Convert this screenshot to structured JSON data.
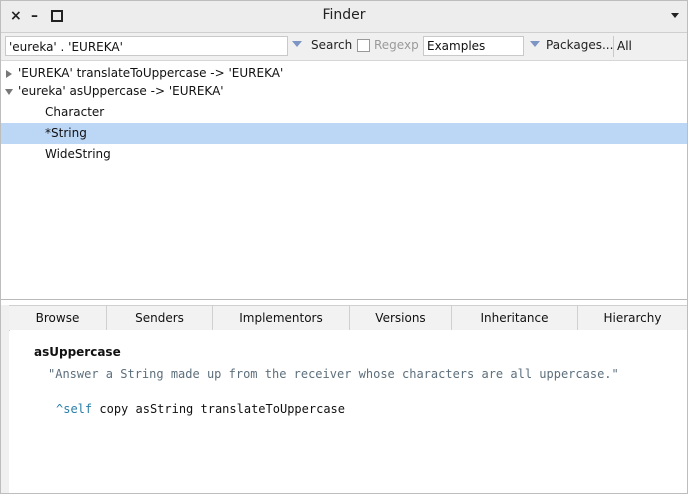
{
  "window": {
    "title": "Finder",
    "close_glyph": "×",
    "minimize_glyph": "–"
  },
  "toolbar": {
    "search_value": "'eureka' . 'EUREKA'",
    "search_label": "Search",
    "regexp_label": "Regexp",
    "regexp_checked": false,
    "mode_value": "Examples",
    "packages_label": "Packages...",
    "all_packages_label": "All Packages"
  },
  "results": [
    {
      "text": "'EUREKA' translateToUppercase -> 'EUREKA'",
      "expanded": false,
      "level": 0
    },
    {
      "text": "'eureka' asUppercase -> 'EUREKA'",
      "expanded": true,
      "level": 0
    },
    {
      "text": "Character",
      "level": 1
    },
    {
      "text": "*String",
      "level": 1,
      "selected": true
    },
    {
      "text": "WideString",
      "level": 1
    }
  ],
  "tabs": [
    "Browse",
    "Senders",
    "Implementors",
    "Versions",
    "Inheritance",
    "Hierarchy"
  ],
  "code": {
    "selector": "asUppercase",
    "comment": "\"Answer a String made up from the receiver whose characters are all uppercase.\"",
    "caret": "^",
    "self_kw": "self",
    "statement_rest": " copy asString translateToUppercase"
  },
  "colors": {
    "selection": "#bcd6f5",
    "keyword": "#2a7ea6",
    "comment": "#5d6f7c"
  }
}
